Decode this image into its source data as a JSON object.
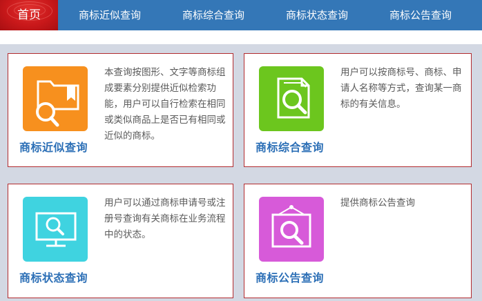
{
  "nav": {
    "home_label": "首页",
    "items": [
      {
        "label": "商标近似查询"
      },
      {
        "label": "商标综合查询"
      },
      {
        "label": "商标状态查询"
      },
      {
        "label": "商标公告查询"
      }
    ]
  },
  "cards": [
    {
      "title": "商标近似查询",
      "description": "本查询按图形、文字等商标组成要素分别提供近似检索功能，用户可以自行检索在相同或类似商品上是否已有相同或近似的商标。",
      "icon": "folder-search-icon",
      "color": "#f7901e"
    },
    {
      "title": "商标综合查询",
      "description": "用户可以按商标号、商标、申请人名称等方式，查询某一商标的有关信息。",
      "icon": "document-search-icon",
      "color": "#6cc61e"
    },
    {
      "title": "商标状态查询",
      "description": "用户可以通过商标申请号或注册号查询有关商标在业务流程中的状态。",
      "icon": "monitor-search-icon",
      "color": "#3fd3e0"
    },
    {
      "title": "商标公告查询",
      "description": "提供商标公告查询",
      "icon": "frame-search-icon",
      "color": "#d75ad9"
    }
  ],
  "colors": {
    "nav_bg": "#3477b7",
    "home_bg": "#c9181a",
    "title": "#2c6fb6",
    "card_border": "#b22a2e",
    "page_bg": "#d3d8e3"
  }
}
